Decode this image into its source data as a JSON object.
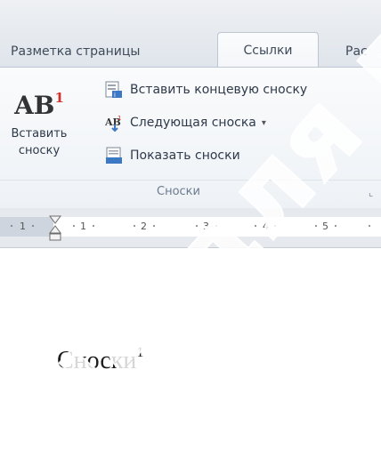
{
  "tabs": {
    "page_layout": "Разметка страницы",
    "references": "Ссылки",
    "review_partial": "Рас"
  },
  "ribbon": {
    "insert_footnote": {
      "icon_text": "AB",
      "icon_superscript": "1",
      "label_line1": "Вставить",
      "label_line2": "сноску"
    },
    "insert_endnote": "Вставить концевую сноску",
    "next_footnote": "Следующая сноска",
    "next_footnote_dropdown": "▾",
    "show_notes": "Показать сноски",
    "group_label": "Сноски",
    "launcher_glyph": "⌞"
  },
  "ruler": {
    "numbers": [
      "1",
      "1",
      "2",
      "3",
      "4",
      "5"
    ]
  },
  "document": {
    "heading": "Сноски",
    "heading_superscript": "1"
  },
  "watermark": "Не для печати",
  "colors": {
    "accent_red": "#d4302a",
    "ribbon_text": "#2e3a4a",
    "group_label": "#6c7b8f",
    "icon_blue": "#3d78c5"
  }
}
